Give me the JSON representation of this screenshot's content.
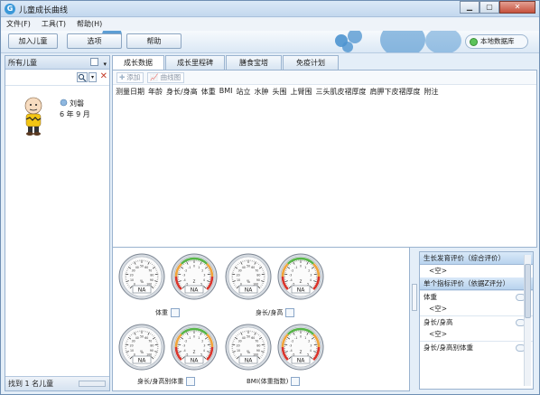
{
  "window": {
    "title": "儿童成长曲线",
    "app_icon": "G"
  },
  "menu": [
    "文件(F)",
    "工具(T)",
    "帮助(H)"
  ],
  "toolbar": {
    "add_child": "加入儿童",
    "options": "选项",
    "help": "帮助",
    "local_db": "本地数据库"
  },
  "left": {
    "header": "所有儿童",
    "child_name": "刘磐",
    "child_age": "6 年 9 月",
    "footer": "找到 1 名儿童"
  },
  "tabs": [
    "成长数据",
    "成长里程碑",
    "膳食宝塔",
    "免疫计划"
  ],
  "subtoolbar": {
    "add": "添加",
    "curve": "曲线图"
  },
  "columns": [
    "测量日期",
    "年龄",
    "身长/身高",
    "体重",
    "BMI",
    "站立",
    "水肿",
    "头围",
    "上臂围",
    "三头肌皮褶厚度",
    "肩胛下皮褶厚度",
    "附注"
  ],
  "gauges": {
    "na": "NA",
    "unit_pct": "%",
    "unit_z": "Z",
    "pairs": [
      {
        "label": "体重"
      },
      {
        "label": "身长/身高"
      },
      {
        "label": "身长/身高别体重"
      },
      {
        "label": "BMI(体重指数)"
      }
    ]
  },
  "evaluation": {
    "overall_head": "生长发育评价（综合评价）",
    "overall_value": "<空>",
    "single_head": "单个指标评价（依据Z评分）",
    "items": [
      {
        "label": "体重",
        "value": "<空>"
      },
      {
        "label": "身长/身高",
        "value": "<空>"
      },
      {
        "label": "身长/身高别体重",
        "value": ""
      }
    ]
  }
}
